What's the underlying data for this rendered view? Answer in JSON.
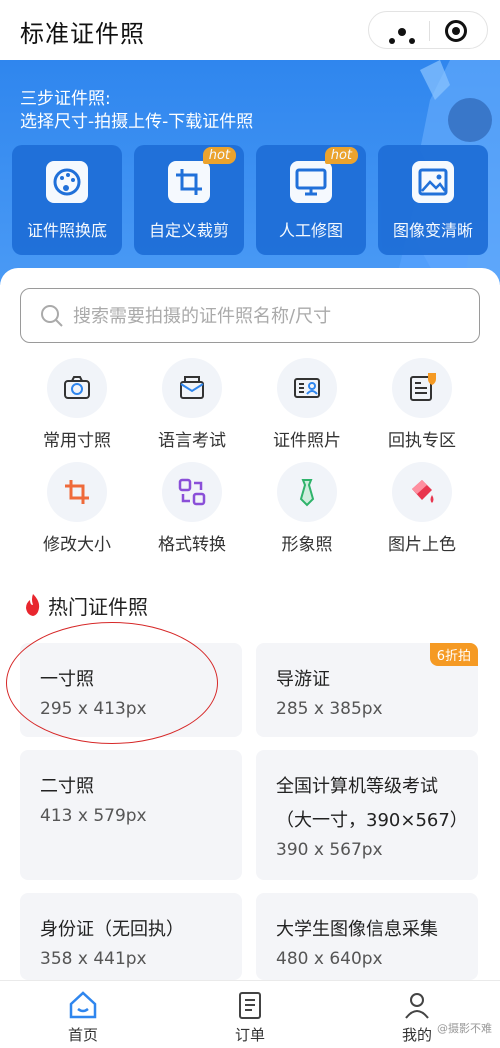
{
  "header": {
    "title": "标准证件照"
  },
  "banner": {
    "line1": "三步证件照:",
    "line2": "选择尺寸-拍摄上传-下载证件照",
    "features": [
      {
        "label": "证件照换底",
        "icon": "palette-icon",
        "badge": ""
      },
      {
        "label": "自定义裁剪",
        "icon": "crop-icon",
        "badge": "hot"
      },
      {
        "label": "人工修图",
        "icon": "monitor-icon",
        "badge": "hot"
      },
      {
        "label": "图像变清晰",
        "icon": "image-icon",
        "badge": ""
      }
    ]
  },
  "search": {
    "placeholder": "搜索需要拍摄的证件照名称/尺寸"
  },
  "categories": [
    {
      "label": "常用寸照",
      "icon": "camera-icon"
    },
    {
      "label": "语言考试",
      "icon": "mail-icon"
    },
    {
      "label": "证件照片",
      "icon": "id-card-icon"
    },
    {
      "label": "回执专区",
      "icon": "receipt-icon"
    },
    {
      "label": "修改大小",
      "icon": "crop-icon"
    },
    {
      "label": "格式转换",
      "icon": "convert-icon"
    },
    {
      "label": "形象照",
      "icon": "tie-icon"
    },
    {
      "label": "图片上色",
      "icon": "paint-bucket-icon"
    }
  ],
  "hot": {
    "title": "热门证件照",
    "items": [
      {
        "name": "一寸照",
        "size": "295 x 413px",
        "badge": ""
      },
      {
        "name": "导游证",
        "size": "285 x 385px",
        "badge": "6折拍"
      },
      {
        "name": "二寸照",
        "size": "413 x 579px",
        "badge": ""
      },
      {
        "name": "全国计算机等级考试（大一寸，390×567）",
        "size": "390 x 567px",
        "badge": ""
      },
      {
        "name": "身份证（无回执）",
        "size": "358 x 441px",
        "badge": ""
      },
      {
        "name": "大学生图像信息采集",
        "size": "480 x 640px",
        "badge": ""
      }
    ]
  },
  "tabs": [
    {
      "label": "首页",
      "icon": "home-icon"
    },
    {
      "label": "订单",
      "icon": "order-icon"
    },
    {
      "label": "我的",
      "icon": "user-icon"
    }
  ],
  "watermark": "@摄影不难",
  "colors": {
    "primary": "#2f86ee",
    "accent": "#f59a24",
    "highlight": "#d62828"
  }
}
